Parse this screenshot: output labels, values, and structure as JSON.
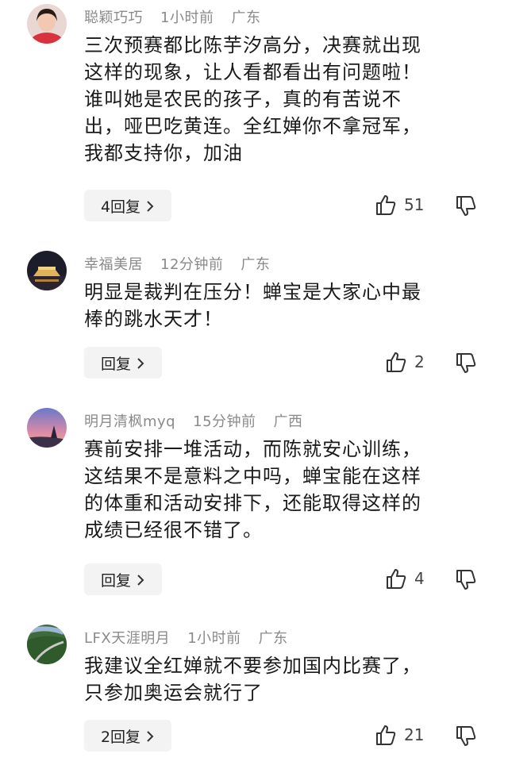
{
  "comments": [
    {
      "username": "聪颖巧巧",
      "time": "1小时前",
      "location": "广东",
      "text": "三次预赛都比陈芋汐高分，决赛就出现\n这样的现象，让人看都看出有问题啦！\n谁叫她是农民的孩子，真的有苦说不\n出，哑巴吃黄连。全红婵你不拿冠军，\n我都支持你，加油",
      "reply_label": "4回复",
      "likes": "51"
    },
    {
      "username": "幸福美居",
      "time": "12分钟前",
      "location": "广东",
      "text": "明显是裁判在压分！蝉宝是大家心中最\n棒的跳水天才！",
      "reply_label": "回复",
      "likes": "2"
    },
    {
      "username": "明月清枫myq",
      "time": "15分钟前",
      "location": "广西",
      "text": "赛前安排一堆活动，而陈就安心训练，\n这结果不是意料之中吗，蝉宝能在这样\n的体重和活动安排下，还能取得这样的\n成绩已经很不错了。",
      "reply_label": "回复",
      "likes": "4"
    },
    {
      "username": "LFX天涯明月",
      "time": "1小时前",
      "location": "广东",
      "text": "我建议全红婵就不要参加国内比赛了，\n只参加奥运会就行了",
      "reply_label": "2回复",
      "likes": "21"
    }
  ],
  "icons": {
    "like": "thumbs-up-icon",
    "dislike": "thumbs-down-icon",
    "chevron": "chevron-right-icon"
  }
}
